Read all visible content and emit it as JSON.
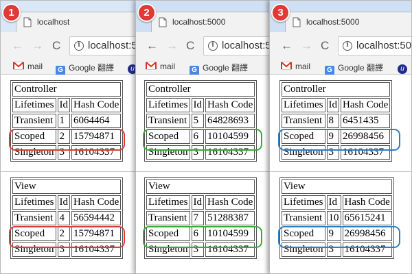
{
  "windows": [
    {
      "badge": "1",
      "tab_title": "localhost",
      "url": "localhost:5",
      "highlight_color": "#e03a36",
      "controller": {
        "title": "Controller",
        "headers": [
          "Lifetimes",
          "Id",
          "Hash Code"
        ],
        "rows": [
          [
            "Transient",
            "1",
            "6064464"
          ],
          [
            "Scoped",
            "2",
            "15794871"
          ],
          [
            "Singleton",
            "3",
            "16104337"
          ]
        ]
      },
      "view": {
        "title": "View",
        "headers": [
          "Lifetimes",
          "Id",
          "Hash Code"
        ],
        "rows": [
          [
            "Transient",
            "4",
            "56594442"
          ],
          [
            "Scoped",
            "2",
            "15794871"
          ],
          [
            "Singleton",
            "3",
            "16104337"
          ]
        ]
      }
    },
    {
      "badge": "2",
      "tab_title": "localhost:5000",
      "url": "localhost:5",
      "highlight_color": "#3aa83a",
      "controller": {
        "title": "Controller",
        "headers": [
          "Lifetimes",
          "Id",
          "Hash Code"
        ],
        "rows": [
          [
            "Transient",
            "5",
            "64828693"
          ],
          [
            "Scoped",
            "6",
            "10104599"
          ],
          [
            "Singleton",
            "3",
            "16104337"
          ]
        ]
      },
      "view": {
        "title": "View",
        "headers": [
          "Lifetimes",
          "Id",
          "Hash Code"
        ],
        "rows": [
          [
            "Transient",
            "7",
            "51288387"
          ],
          [
            "Scoped",
            "6",
            "10104599"
          ],
          [
            "Singleton",
            "3",
            "16104337"
          ]
        ]
      }
    },
    {
      "badge": "3",
      "tab_title": "localhost:5000",
      "url": "localhost:500",
      "highlight_color": "#2f7ec0",
      "controller": {
        "title": "Controller",
        "headers": [
          "Lifetimes",
          "Id",
          "Hash Code"
        ],
        "rows": [
          [
            "Transient",
            "8",
            "6451435"
          ],
          [
            "Scoped",
            "9",
            "26998456"
          ],
          [
            "Singleton",
            "3",
            "16104337"
          ]
        ]
      },
      "view": {
        "title": "View",
        "headers": [
          "Lifetimes",
          "Id",
          "Hash Code"
        ],
        "rows": [
          [
            "Transient",
            "10",
            "65615241"
          ],
          [
            "Scoped",
            "9",
            "26998456"
          ],
          [
            "Singleton",
            "3",
            "16104337"
          ]
        ]
      }
    }
  ],
  "bookmarks": {
    "mail": "mail",
    "google_translate": "Google 翻譯",
    "third_icon": "u-bookmark-icon"
  },
  "icons": {
    "back": "←",
    "forward": "→",
    "reload": "C",
    "close": "×",
    "info": "i",
    "google": "G",
    "u": "u"
  }
}
